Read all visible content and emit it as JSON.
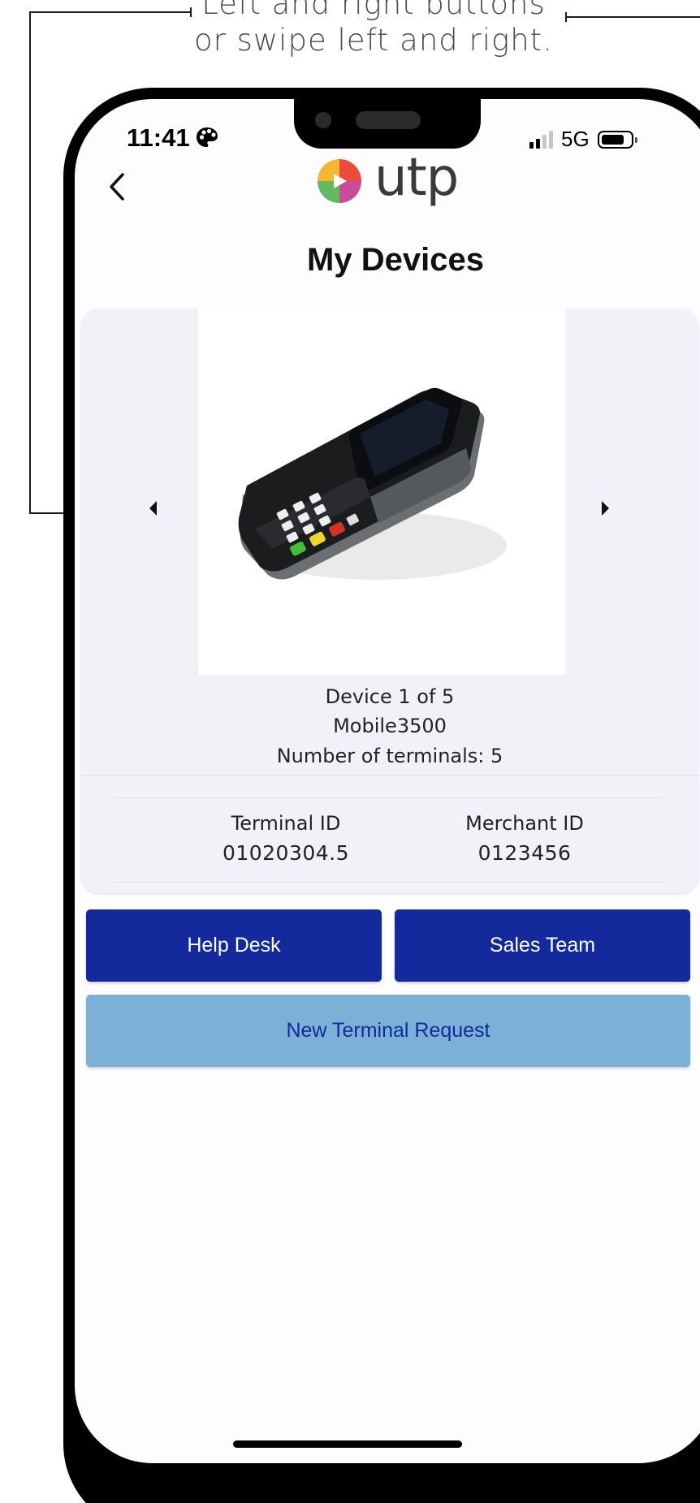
{
  "annotation": {
    "line1": "Left and right buttons",
    "line2": "or swipe left and right."
  },
  "status_bar": {
    "time": "11:41",
    "network": "5G",
    "battery_level": 0.8,
    "signal_bars_active": 2,
    "signal_bars_total": 4
  },
  "header": {
    "brand": "utp",
    "title": "My Devices"
  },
  "device": {
    "position_text": "Device 1 of 5",
    "model": "Mobile3500",
    "terminals_text": "Number of terminals: 5",
    "terminal_id_label": "Terminal ID",
    "terminal_id_value": "01020304.5",
    "merchant_id_label": "Merchant ID",
    "merchant_id_value": "0123456"
  },
  "buttons": {
    "help_desk": "Help Desk",
    "sales_team": "Sales Team",
    "new_terminal_request": "New Terminal Request"
  },
  "colors": {
    "primary": "#13299c",
    "secondary": "#7bb1d7",
    "card_bg": "#f1f2f8"
  }
}
